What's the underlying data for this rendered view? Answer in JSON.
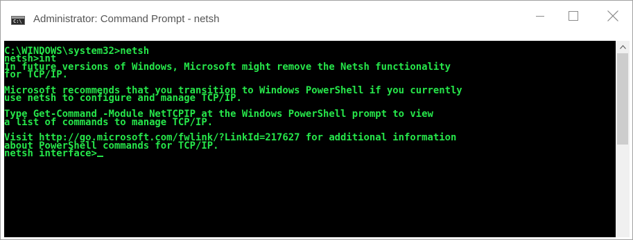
{
  "window": {
    "title": "Administrator: Command Prompt - netsh",
    "icon": "cmd-icon",
    "controls": {
      "minimize_icon": "minimize-icon",
      "maximize_icon": "maximize-icon",
      "close_icon": "close-icon"
    }
  },
  "console": {
    "text_color": "#26e64a",
    "background": "#000000",
    "lines": [
      "C:\\WINDOWS\\system32>netsh",
      "netsh>int",
      "In future versions of Windows, Microsoft might remove the Netsh functionality",
      "for TCP/IP.",
      "",
      "Microsoft recommends that you transition to Windows PowerShell if you currently",
      "use netsh to configure and manage TCP/IP.",
      "",
      "Type Get-Command -Module NetTCPIP at the Windows PowerShell prompt to view",
      "a list of commands to manage TCP/IP.",
      "",
      "Visit http://go.microsoft.com/fwlink/?LinkId=217627 for additional information",
      "about PowerShell commands for TCP/IP.",
      "netsh interface>"
    ]
  },
  "scrollbar": {
    "up_icon": "scroll-up-arrow-icon"
  }
}
